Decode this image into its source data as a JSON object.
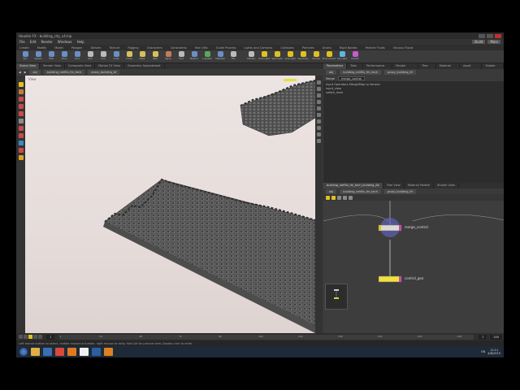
{
  "window": {
    "title": "Houdini FX - building_city_v4.hip",
    "path_tab": "Building_Netflix_Fm_Tech"
  },
  "menu": {
    "items": [
      "File",
      "Edit",
      "Render",
      "Windows",
      "Help"
    ],
    "desktop_label": "Build",
    "main_label": "Main"
  },
  "shelf_tabs": [
    "Create",
    "Modify",
    "Model",
    "Polygon",
    "Deform",
    "Texture",
    "Rigging",
    "Characters",
    "Constraints",
    "Hair Utils",
    "Guide Process",
    "Lights and Cameras",
    "Collisions",
    "Particles",
    "Grains",
    "Rigid Bodies",
    "Particle Fluids",
    "Viscous Fluids"
  ],
  "shelf_tools": [
    {
      "label": "Box",
      "color": "#6a8fc7"
    },
    {
      "label": "Sphere",
      "color": "#6a8fc7"
    },
    {
      "label": "Tube",
      "color": "#6a8fc7"
    },
    {
      "label": "Torus",
      "color": "#6a8fc7"
    },
    {
      "label": "Grid",
      "color": "#6a8fc7"
    },
    {
      "label": "Null",
      "color": "#bbbbbb"
    },
    {
      "label": "Line",
      "color": "#bbbbbb"
    },
    {
      "label": "Circle",
      "color": "#6a8fc7"
    },
    {
      "label": "Curve",
      "color": "#d8c05a"
    },
    {
      "label": "Draw",
      "color": "#d8c05a"
    },
    {
      "label": "Path",
      "color": "#d8c05a"
    },
    {
      "label": "Spray",
      "color": "#c77a5a"
    },
    {
      "label": "Font",
      "color": "#bbbbbb"
    },
    {
      "label": "Platonic",
      "color": "#6a8fc7"
    },
    {
      "label": "L-System",
      "color": "#5aa85a"
    },
    {
      "label": "Metaball",
      "color": "#6a8fc7"
    },
    {
      "label": "File",
      "color": "#bbbbbb"
    },
    {
      "label": "Camera",
      "color": "#bbbbbb"
    },
    {
      "label": "Point Light",
      "color": "#e0c020"
    },
    {
      "label": "Spot Light",
      "color": "#e0c020"
    },
    {
      "label": "Area Light",
      "color": "#e0c020"
    },
    {
      "label": "Geometry",
      "color": "#e0c020"
    },
    {
      "label": "Volume",
      "color": "#e0c020"
    },
    {
      "label": "Environment",
      "color": "#e0c020"
    },
    {
      "label": "Sky Light",
      "color": "#5ab8e0"
    },
    {
      "label": "Caustic",
      "color": "#c75ad0"
    }
  ],
  "left_pane": {
    "tabs": [
      "Scene View",
      "Render View",
      "Composite View",
      "Motion FX View",
      "Geometry Spreadsheet"
    ],
    "active_tab": 0,
    "crumbs": [
      "obj",
      "building_netflix_fm_tech",
      "proxy_building_tif"
    ],
    "view_label": "View"
  },
  "right_top": {
    "tabs": [
      "Parameters",
      "Take List",
      "Performance Monitor",
      "Render Scheduler",
      "Tree View",
      "Material Palette",
      "Asset Browser",
      "Shader Guide"
    ],
    "crumbs": [
      "obj",
      "building_netflix_fm_tech",
      "proxy_building_tif"
    ],
    "node_type": "Merge",
    "node_name": "merge_control",
    "param_header": "Input Operators Merge/Map to Version",
    "inputs": [
      "input_view",
      "switch_level"
    ]
  },
  "network": {
    "tabs": [
      "building_netflix_fm_tech_building_Alt",
      "Tree View",
      "Material Palette",
      "Shader View"
    ],
    "crumbs": [
      "obj",
      "building_netflix_fm_tech",
      "proxy_building_tif"
    ],
    "nodes": [
      {
        "label": "merge_control"
      },
      {
        "label": "control_geo"
      }
    ]
  },
  "timeline": {
    "ticks": [
      "1",
      "24",
      "48",
      "72",
      "96",
      "120",
      "144",
      "168",
      "192",
      "216",
      "240"
    ],
    "start_frame": "1",
    "current_frame": "1",
    "end_frame": "240"
  },
  "status": "Left mouse button to select, middle mouse to tumble, right mouse to dolly. Hold Alt for precise view. Double-click to enter.",
  "taskbar": {
    "icons": [
      {
        "name": "explorer-icon",
        "color": "#e0b040"
      },
      {
        "name": "media-icon",
        "color": "#3a6fb0"
      },
      {
        "name": "chrome-icon",
        "color": "#d84a3a"
      },
      {
        "name": "firefox-icon",
        "color": "#e07a20"
      },
      {
        "name": "houdini-icon",
        "color": "#f0f0f0"
      },
      {
        "name": "photoshop-icon",
        "color": "#2a5fa0"
      },
      {
        "name": "vlc-icon",
        "color": "#e08020"
      }
    ],
    "lang": "EN",
    "time": "11:11",
    "date": "4/8/2015"
  }
}
